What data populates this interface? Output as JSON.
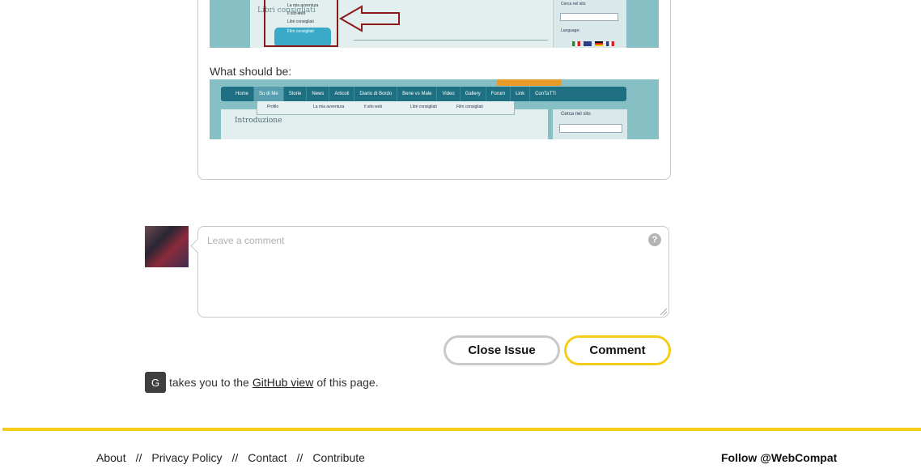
{
  "issue": {
    "screenshot_current": {
      "breadcrumb": "Libri consigliati",
      "menu_items": [
        "La mia avventura",
        "Il sito web",
        "Libri consigliati",
        "Film consigliati"
      ],
      "sidebar_search": "Cerca nel sito",
      "sidebar_language": "Language:"
    },
    "caption": "What should be:",
    "screenshot_expected": {
      "nav": [
        "Home",
        "Su di Me",
        "Storie",
        "News",
        "Articoli",
        "Diario di Bordo",
        "Bene vs Male",
        "Video",
        "Gallery",
        "Forum",
        "Link",
        "ConTaTTi"
      ],
      "submenu": [
        "Profilo",
        "La mia avventura",
        "Il sito web",
        "Libri consigliati",
        "Film consigliati"
      ],
      "intro": "Introduzione",
      "sidebar_search": "Cerca nel sito"
    }
  },
  "comment_form": {
    "placeholder": "Leave a comment",
    "help_icon": "?",
    "close_label": "Close Issue",
    "comment_label": "Comment"
  },
  "hint": {
    "key": "G",
    "before": "takes you to the",
    "link": "GitHub view",
    "after": "of this page."
  },
  "footer": {
    "links": [
      "About",
      "Privacy Policy",
      "Contact",
      "Contribute"
    ],
    "separator": "//",
    "follow": "Follow @WebCompat"
  },
  "colors": {
    "accent": "#f6cc1a",
    "border": "#c8c8c8"
  }
}
